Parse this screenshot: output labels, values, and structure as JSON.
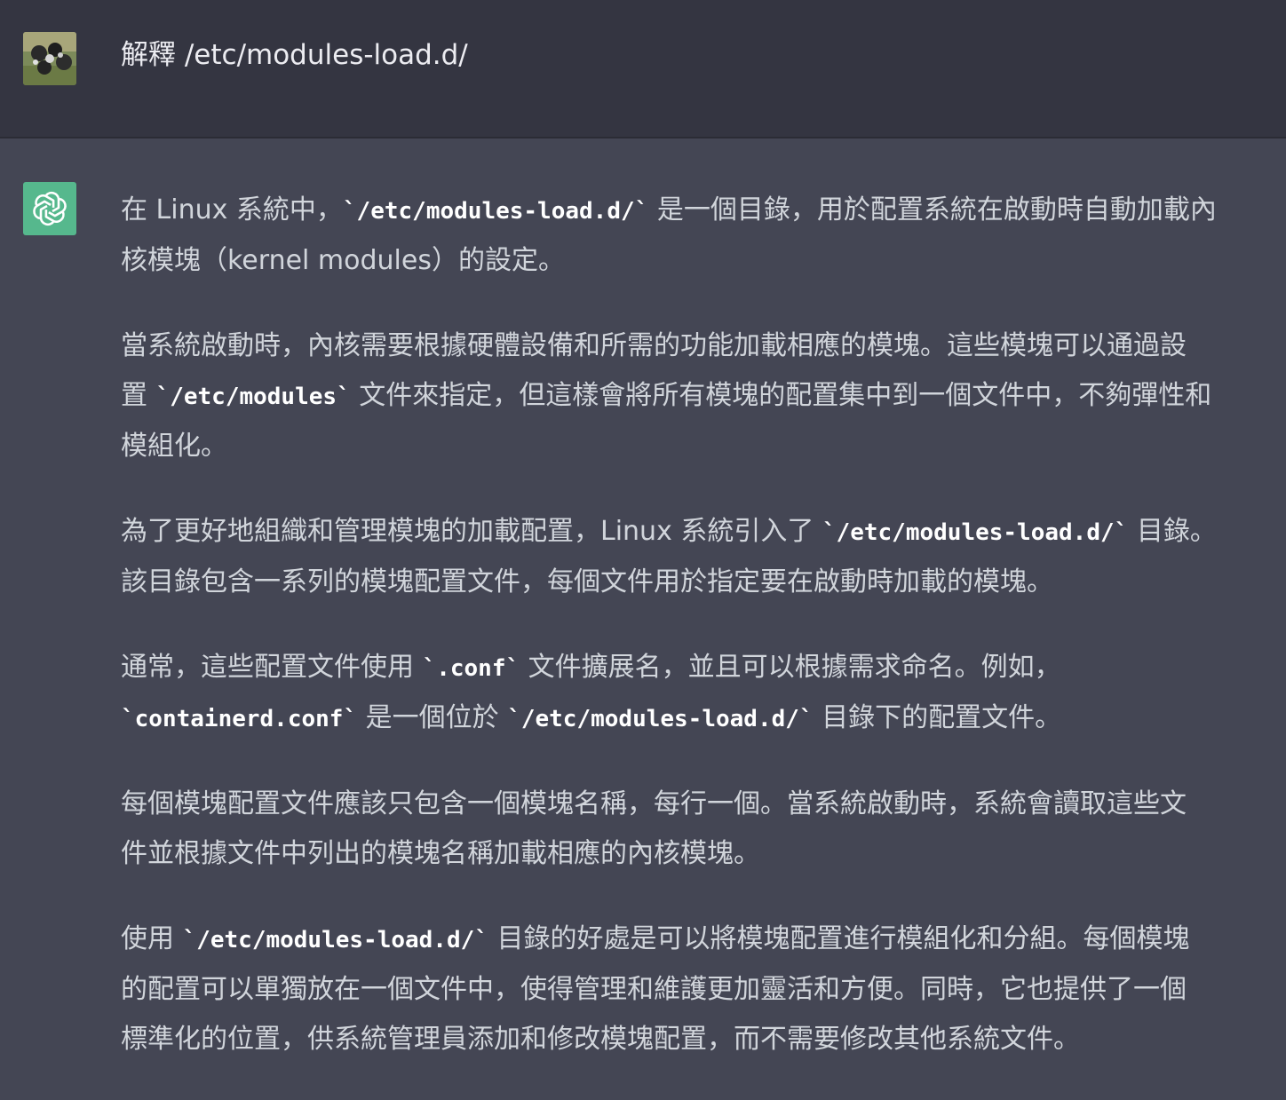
{
  "user": {
    "avatar": "user-avatar-photo",
    "message": "解釋 /etc/modules-load.d/"
  },
  "assistant": {
    "icon": "openai-logo-icon",
    "paragraphs": [
      {
        "lines": [
          [
            "在 Linux 系統中，",
            "`/etc/modules-load.d/`",
            " 是一個目錄，用於配置系統在啟動時自動加載內"
          ],
          [
            "核模塊（kernel modules）的設定。"
          ]
        ]
      },
      {
        "lines": [
          [
            "當系統啟動時，內核需要根據硬體設備和所需的功能加載相應的模塊。這些模塊可以通過設"
          ],
          [
            "置 ",
            "`/etc/modules`",
            " 文件來指定，但這樣會將所有模塊的配置集中到一個文件中，不夠彈性和"
          ],
          [
            "模組化。"
          ]
        ]
      },
      {
        "lines": [
          [
            "為了更好地組織和管理模塊的加載配置，Linux 系統引入了 ",
            "`/etc/modules-load.d/`",
            " 目錄。"
          ],
          [
            "該目錄包含一系列的模塊配置文件，每個文件用於指定要在啟動時加載的模塊。"
          ]
        ]
      },
      {
        "lines": [
          [
            "通常，這些配置文件使用 ",
            "`.conf`",
            " 文件擴展名，並且可以根據需求命名。例如，"
          ],
          [
            "",
            "`containerd.conf`",
            " 是一個位於 ",
            "`/etc/modules-load.d/`",
            " 目錄下的配置文件。"
          ]
        ]
      },
      {
        "lines": [
          [
            "每個模塊配置文件應該只包含一個模塊名稱，每行一個。當系統啟動時，系統會讀取這些文"
          ],
          [
            "件並根據文件中列出的模塊名稱加載相應的內核模塊。"
          ]
        ]
      },
      {
        "lines": [
          [
            "使用 ",
            "`/etc/modules-load.d/`",
            " 目錄的好處是可以將模塊配置進行模組化和分組。每個模塊"
          ],
          [
            "的配置可以單獨放在一個文件中，使得管理和維護更加靈活和方便。同時，它也提供了一個"
          ],
          [
            "標準化的位置，供系統管理員添加和修改模塊配置，而不需要修改其他系統文件。"
          ]
        ]
      }
    ]
  },
  "colors": {
    "user_bg": "#343541",
    "assistant_bg": "#444654",
    "text": "#d1d5db",
    "code": "#ffffff",
    "gpt_icon_bg": "#56b88d"
  }
}
